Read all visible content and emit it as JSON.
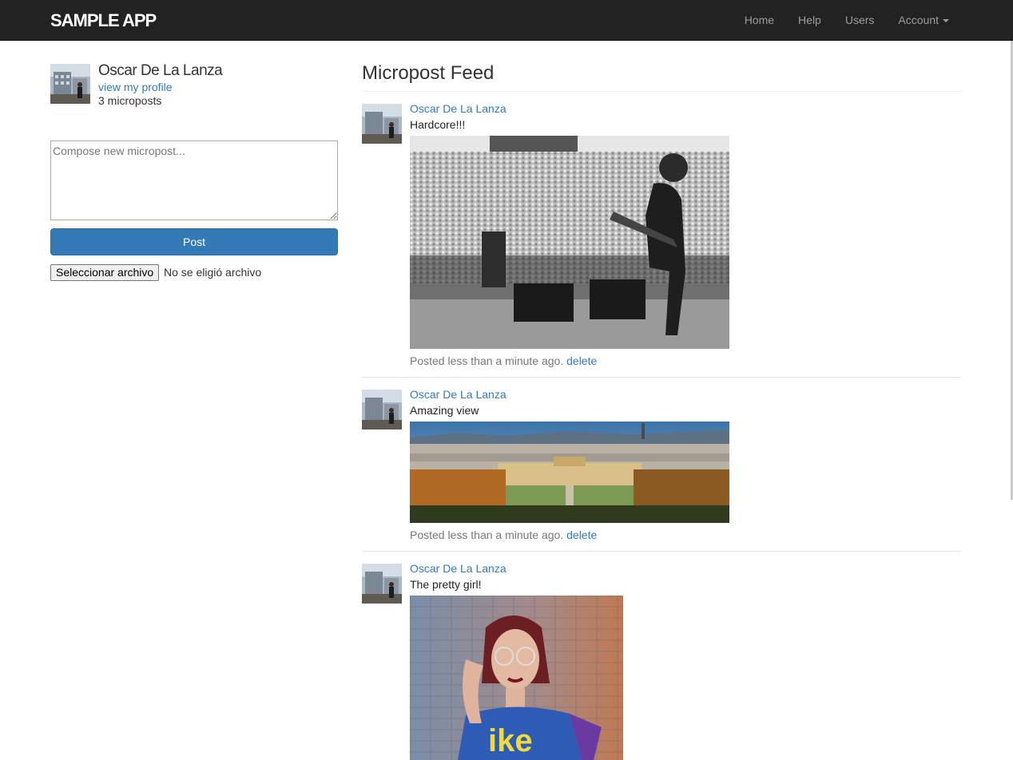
{
  "navbar": {
    "brand": "SAMPLE APP",
    "links": [
      "Home",
      "Help",
      "Users",
      "Account"
    ]
  },
  "sidebar": {
    "user_name": "Oscar De La Lanza",
    "profile_link": "view my profile",
    "micropost_count": "3 microposts",
    "compose_placeholder": "Compose new micropost...",
    "post_button": "Post",
    "file_button": "Seleccionar archivo",
    "file_status": "No se eligió archivo"
  },
  "feed": {
    "title": "Micropost Feed",
    "posts": [
      {
        "user": "Oscar De La Lanza",
        "content": "Hardcore!!!",
        "timestamp": "Posted less than a minute ago.",
        "delete": "delete",
        "image": "concert-photo"
      },
      {
        "user": "Oscar De La Lanza",
        "content": "Amazing view",
        "timestamp": "Posted less than a minute ago.",
        "delete": "delete",
        "image": "city-palace-photo"
      },
      {
        "user": "Oscar De La Lanza",
        "content": "The pretty girl!",
        "image": "portrait-photo"
      }
    ]
  },
  "colors": {
    "navbar_bg": "#222222",
    "link": "#337ab7",
    "primary_button": "#337ab7"
  }
}
